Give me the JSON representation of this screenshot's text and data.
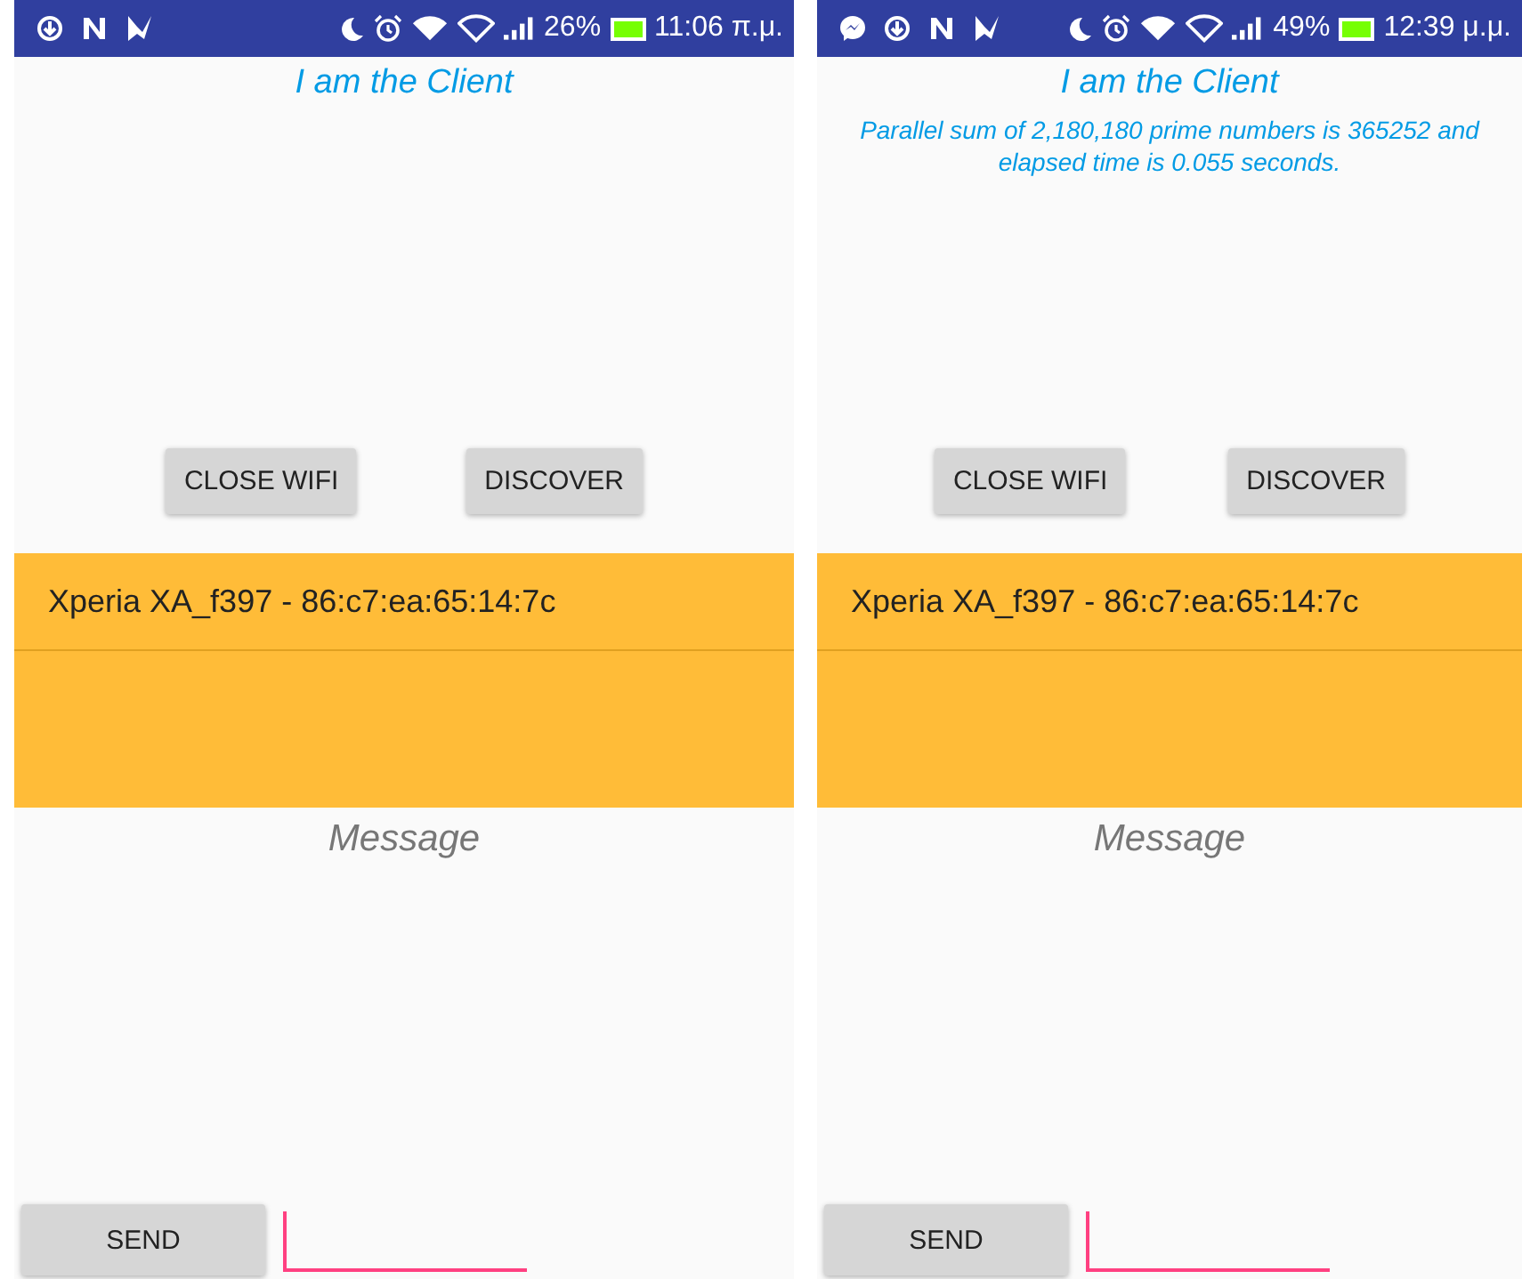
{
  "phones": [
    {
      "status_bar": {
        "notifications": [
          {
            "kind": "download"
          },
          {
            "kind": "n"
          },
          {
            "kind": "check"
          }
        ],
        "battery": "26%",
        "time": "11:06 π.μ."
      },
      "title": "I am the Client",
      "buttons": [
        "CLOSE WIFI",
        "DISCOVER"
      ],
      "devices": [
        {
          "name": "Xperia XA_f397 - 86:c7:ea:65:14:7c"
        }
      ],
      "message": "Message",
      "send_button": "SEND"
    },
    {
      "status_bar": {
        "notifications": [
          {
            "kind": "messenger"
          },
          {
            "kind": "download"
          },
          {
            "kind": "n"
          },
          {
            "kind": "check"
          }
        ],
        "battery": "49%",
        "time": "12:39 μ.μ."
      },
      "title": "I am the Client",
      "result": "Parallel sum of 2,180,180 prime numbers is 365252 and elapsed time is 0.055 seconds.",
      "buttons": [
        "CLOSE WIFI",
        "DISCOVER"
      ],
      "devices": [
        {
          "name": "Xperia XA_f397 - 86:c7:ea:65:14:7c"
        }
      ],
      "message": "Message",
      "send_button": "SEND"
    }
  ]
}
